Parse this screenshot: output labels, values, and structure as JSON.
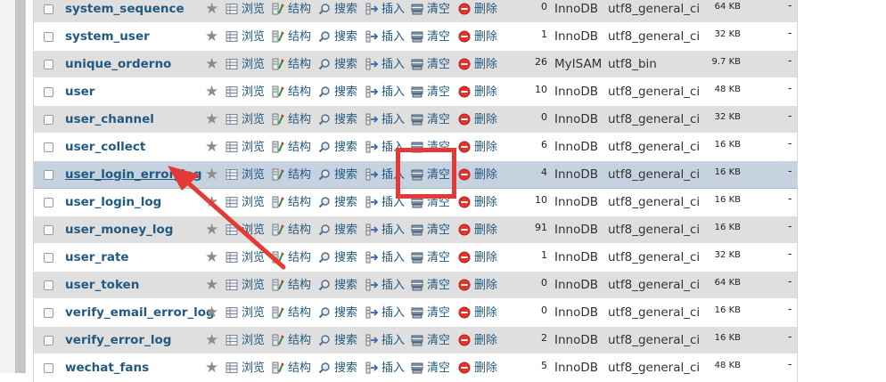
{
  "actions": {
    "browse": "浏览",
    "structure": "结构",
    "search": "搜索",
    "insert": "插入",
    "empty": "清空",
    "drop": "删除"
  },
  "overhead_placeholder": "-",
  "size_unit": "KB",
  "rows": [
    {
      "name": "system_sequence",
      "rows": "0",
      "engine": "InnoDB",
      "collation": "utf8_general_ci",
      "size": "64 KB"
    },
    {
      "name": "system_user",
      "rows": "1",
      "engine": "InnoDB",
      "collation": "utf8_general_ci",
      "size": "32 KB"
    },
    {
      "name": "unique_orderno",
      "rows": "26",
      "engine": "MyISAM",
      "collation": "utf8_bin",
      "size": "9.7 KB"
    },
    {
      "name": "user",
      "rows": "10",
      "engine": "InnoDB",
      "collation": "utf8_general_ci",
      "size": "48 KB"
    },
    {
      "name": "user_channel",
      "rows": "0",
      "engine": "InnoDB",
      "collation": "utf8_general_ci",
      "size": "32 KB"
    },
    {
      "name": "user_collect",
      "rows": "6",
      "engine": "InnoDB",
      "collation": "utf8_general_ci",
      "size": "16 KB"
    },
    {
      "name": "user_login_error_log",
      "rows": "4",
      "engine": "InnoDB",
      "collation": "utf8_general_ci",
      "size": "16 KB",
      "selected": true
    },
    {
      "name": "user_login_log",
      "rows": "10",
      "engine": "InnoDB",
      "collation": "utf8_general_ci",
      "size": "16 KB"
    },
    {
      "name": "user_money_log",
      "rows": "91",
      "engine": "InnoDB",
      "collation": "utf8_general_ci",
      "size": "16 KB"
    },
    {
      "name": "user_rate",
      "rows": "1",
      "engine": "InnoDB",
      "collation": "utf8_general_ci",
      "size": "32 KB"
    },
    {
      "name": "user_token",
      "rows": "0",
      "engine": "InnoDB",
      "collation": "utf8_general_ci",
      "size": "64 KB"
    },
    {
      "name": "verify_email_error_log",
      "rows": "0",
      "engine": "InnoDB",
      "collation": "utf8_general_ci",
      "size": "16 KB"
    },
    {
      "name": "verify_error_log",
      "rows": "2",
      "engine": "InnoDB",
      "collation": "utf8_general_ci",
      "size": "16 KB"
    },
    {
      "name": "wechat_fans",
      "rows": "5",
      "engine": "InnoDB",
      "collation": "utf8_general_ci",
      "size": "48 KB"
    }
  ],
  "annotation_color": "#e53935",
  "link_color": "#235a81"
}
